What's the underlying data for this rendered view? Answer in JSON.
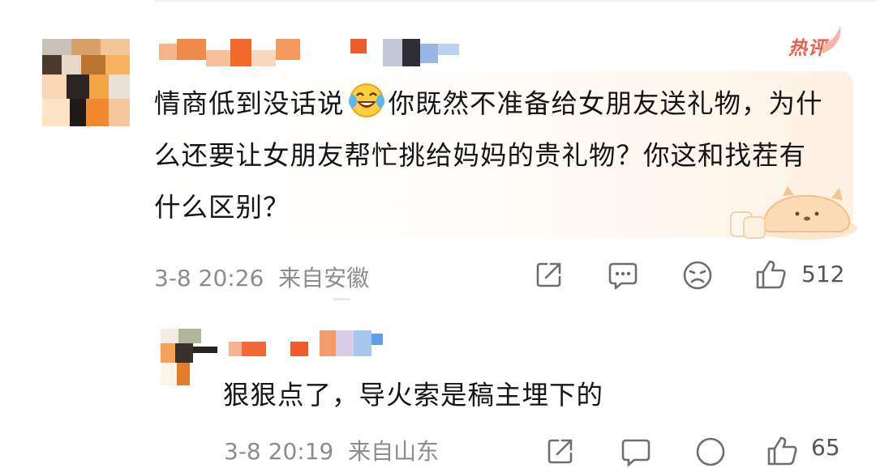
{
  "comment": {
    "badge": "热评",
    "text_before_emoji": "情商低到没话说",
    "emoji_icon": "laughing-tears-emoji",
    "text_after_emoji": "你既然不准备给女朋友送礼物，为什么还要让女朋友帮忙挑给妈妈的贵礼物？你这和找茬有什么区别？",
    "time": "3-8 20:26",
    "location": "来自安徽",
    "actions": {
      "share_icon": "share-icon",
      "reply_icon": "comment-icon",
      "dislike_icon": "dislike-face-icon",
      "like_icon": "thumbs-up-icon",
      "like_count": "512"
    }
  },
  "reply": {
    "text": "狠狠点了，导火索是稿主埋下的",
    "time": "3-8 20:19",
    "location": "来自山东",
    "like_count": "65"
  },
  "colors": {
    "hot_badge": "#e8604f",
    "meta_gray": "#8c8c8c",
    "icon_gray": "#6e6e6e"
  }
}
